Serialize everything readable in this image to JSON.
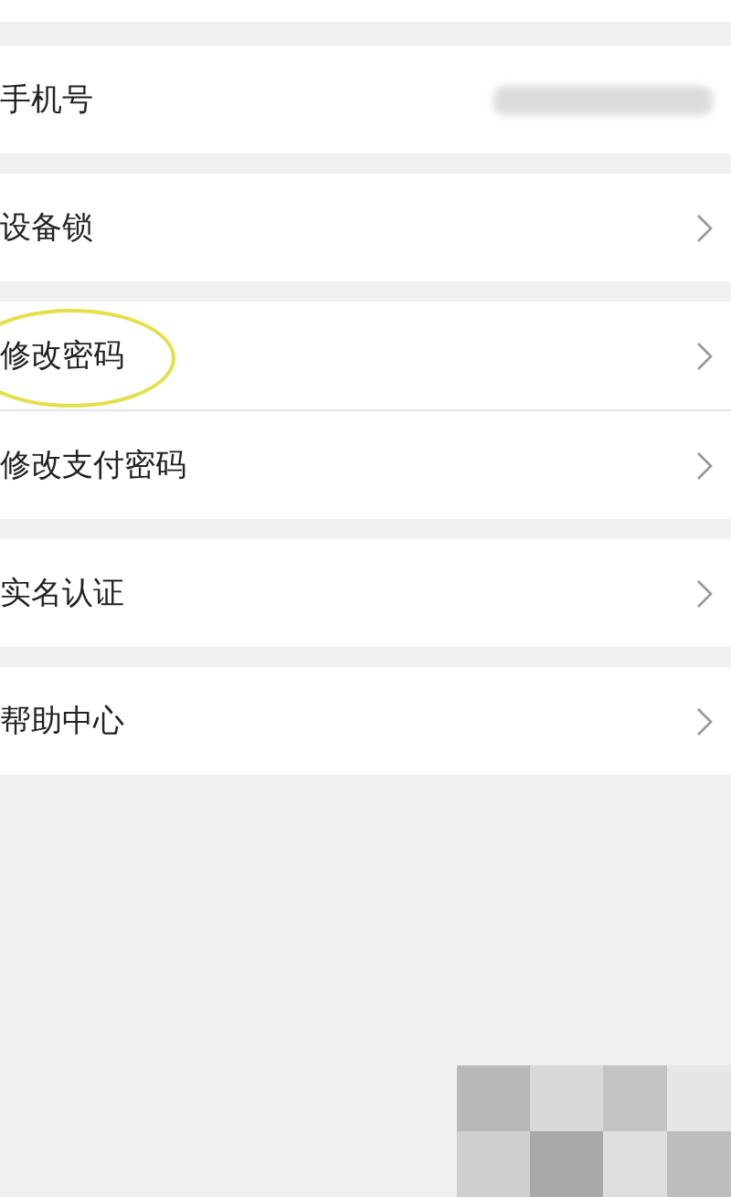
{
  "groups": [
    {
      "items": [
        {
          "label": "手机号",
          "kind": "value",
          "highlighted": false
        }
      ]
    },
    {
      "items": [
        {
          "label": "设备锁",
          "kind": "link",
          "highlighted": false
        }
      ]
    },
    {
      "items": [
        {
          "label": "修改密码",
          "kind": "link",
          "highlighted": true
        },
        {
          "label": "修改支付密码",
          "kind": "link",
          "highlighted": false
        }
      ]
    },
    {
      "items": [
        {
          "label": "实名认证",
          "kind": "link",
          "highlighted": false
        }
      ]
    },
    {
      "items": [
        {
          "label": "帮助中心",
          "kind": "link",
          "highlighted": false
        }
      ]
    }
  ]
}
